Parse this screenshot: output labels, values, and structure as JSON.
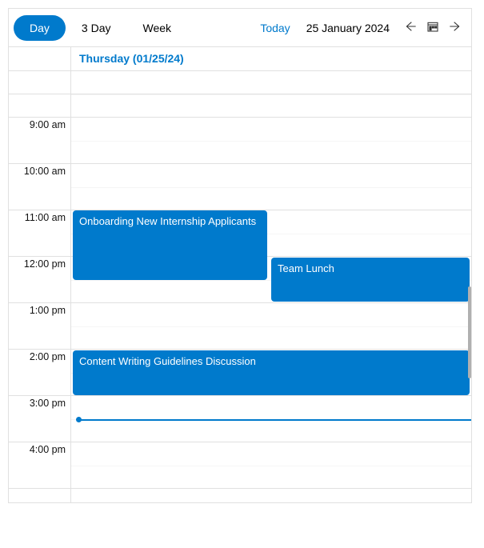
{
  "toolbar": {
    "tabs": {
      "day": "Day",
      "threeDay": "3 Day",
      "week": "Week"
    },
    "today": "Today",
    "dateLabel": "25 January 2024"
  },
  "header": {
    "dayLabel": "Thursday (01/25/24)"
  },
  "timeLabels": {
    "h9": "9:00 am",
    "h10": "10:00 am",
    "h11": "11:00 am",
    "h12": "12:00 pm",
    "h13": "1:00 pm",
    "h14": "2:00 pm",
    "h15": "3:00 pm",
    "h16": "4:00 pm"
  },
  "events": {
    "e1": {
      "title": "Onboarding New Internship Applicants",
      "start": "11:00 am",
      "end": "12:30 pm"
    },
    "e2": {
      "title": "Team Lunch",
      "start": "12:30 pm",
      "end": "1:30 pm"
    },
    "e3": {
      "title": "Content Writing Guidelines Discussion",
      "start": "2:00 pm",
      "end": "3:00 pm"
    }
  },
  "now": "3:30 pm",
  "colors": {
    "accent": "#007acc"
  }
}
